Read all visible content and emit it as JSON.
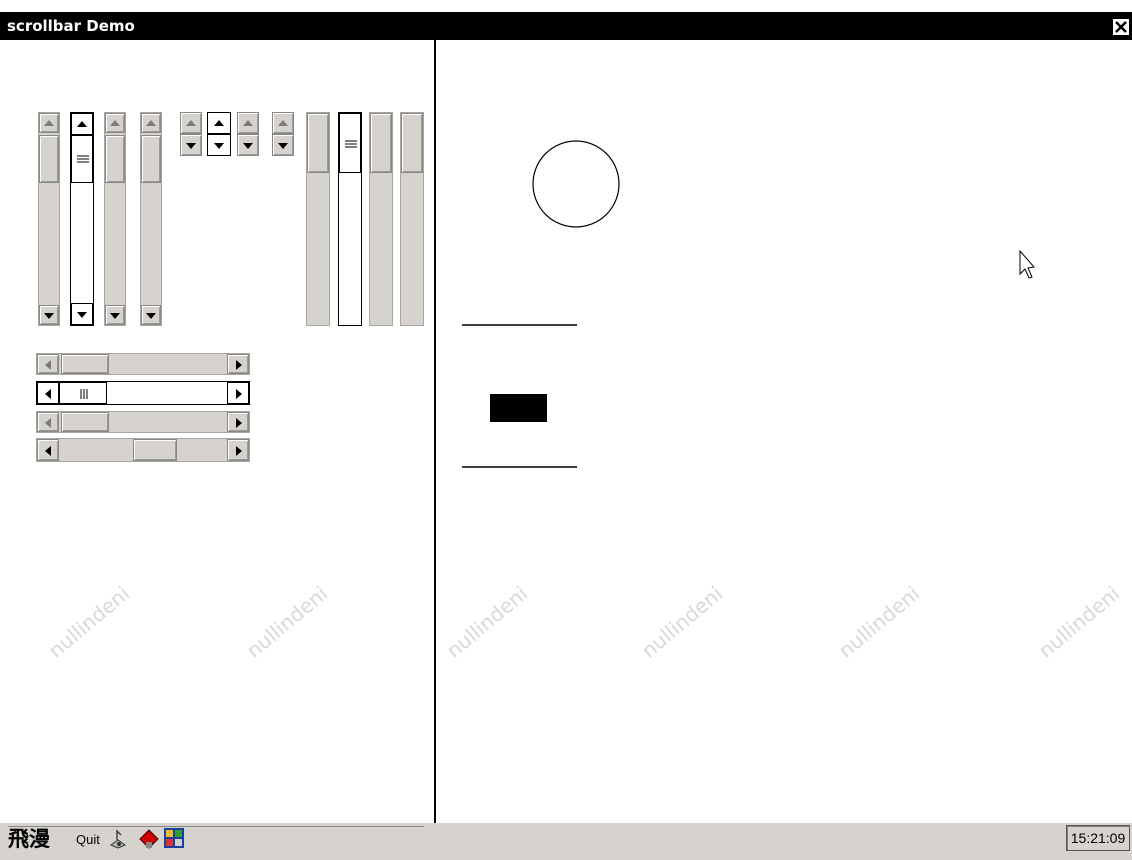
{
  "window": {
    "title": "scrollbar Demo"
  },
  "watermark": {
    "text": "nullindeni"
  },
  "taskbar": {
    "start_label": "飛漫",
    "quit_label": "Quit",
    "clock": "15:21:09"
  }
}
